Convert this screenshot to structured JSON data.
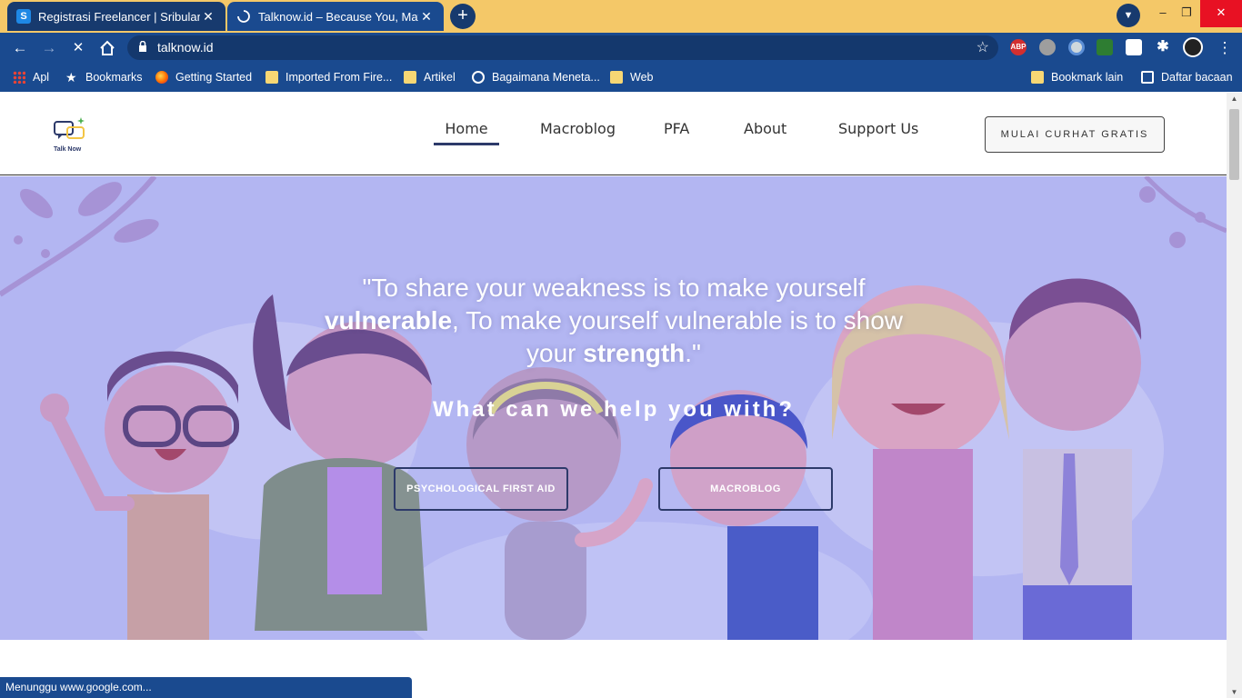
{
  "browser": {
    "tabs": [
      {
        "title": "Registrasi Freelancer | Sribulancer",
        "favicon": "S",
        "active": false
      },
      {
        "title": "Talknow.id – Because You, Matter",
        "favicon": "loading-spinner",
        "active": true
      }
    ],
    "new_tab_label": "+",
    "url": "talknow.id",
    "window_controls": {
      "minimize": "–",
      "restore": "❐",
      "close": "✕"
    },
    "extensions": [
      "ABP",
      "cloud",
      "circle",
      "puzzle-green",
      "shield",
      "puzzle",
      "avatar"
    ],
    "bookmarks": [
      {
        "label": "Apl",
        "icon": "apps-grid-icon"
      },
      {
        "label": "Bookmarks",
        "icon": "star-icon"
      },
      {
        "label": "Getting Started",
        "icon": "firefox-icon"
      },
      {
        "label": "Imported From Fire...",
        "icon": "folder-icon"
      },
      {
        "label": "Artikel",
        "icon": "folder-icon"
      },
      {
        "label": "Bagaimana Meneta...",
        "icon": "globe-icon"
      },
      {
        "label": "Web",
        "icon": "folder-icon"
      }
    ],
    "bookmarks_right": [
      {
        "label": "Bookmark lain",
        "icon": "folder-icon"
      },
      {
        "label": "Daftar bacaan",
        "icon": "reading-list-icon"
      }
    ],
    "status_text": "Menunggu www.google.com..."
  },
  "site": {
    "logo_text": "Talk Now",
    "nav": [
      {
        "label": "Home",
        "active": true
      },
      {
        "label": "Macroblog",
        "active": false
      },
      {
        "label": "PFA",
        "active": false
      },
      {
        "label": "About",
        "active": false
      },
      {
        "label": "Support Us",
        "active": false
      }
    ],
    "cta_label": "MULAI CURHAT GRATIS"
  },
  "hero": {
    "quote_part1": "\"To share your weakness is to make yourself ",
    "quote_bold1": "vulnerable",
    "quote_part2": ", To make yourself vulnerable is to show your ",
    "quote_bold2": "strength",
    "quote_part3": ".\"",
    "help_heading": "What can we help you with?",
    "buttons": [
      {
        "label": "PSYCHOLOGICAL FIRST AID"
      },
      {
        "label": "MACROBLOG"
      }
    ],
    "colors": {
      "overlay": "#b3b6f2",
      "button_border": "#2d3a6a"
    }
  }
}
